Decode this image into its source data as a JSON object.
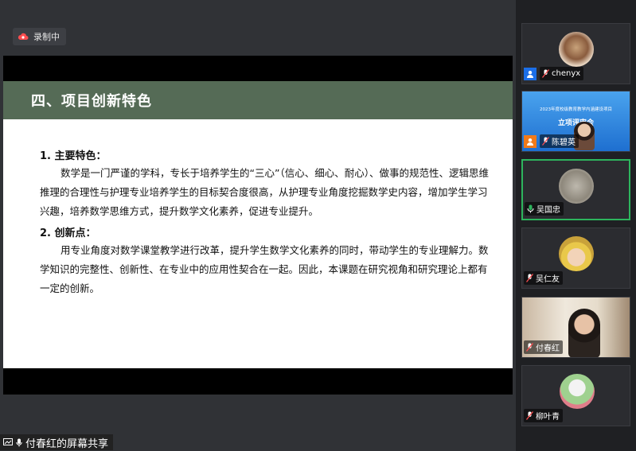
{
  "recording": {
    "label": "录制中"
  },
  "slide": {
    "title": "四、项目创新特色",
    "section1": {
      "heading": "1.  主要特色：",
      "paragraph": "数学是一门严谨的学科，专长于培养学生的“三心”（信心、细心、耐心）、做事的规范性、逻辑思维推理的合理性与护理专业培养学生的目标契合度很高，从护理专业角度挖掘数学史内容，增加学生学习兴趣，培养数学思维方式，提升数学文化素养，促进专业提升。"
    },
    "section2": {
      "heading": "2.   创新点：",
      "paragraph": "用专业角度对数学课堂教学进行改革，提升学生数学文化素养的同时，带动学生的专业理解力。数学知识的完整性、创新性、在专业中的应用性契合在一起。因此，本课题在研究视角和研究理论上都有一定的创新。"
    }
  },
  "screen_share": {
    "label": "付春红的屏幕共享"
  },
  "participants": [
    {
      "name": "chenyx",
      "video_title_line1": "",
      "video_title_line2": ""
    },
    {
      "name": "陈碧英",
      "video_title_line1": "2023年度校级教育教学内涵建设项目",
      "video_title_line2": "立项评审会"
    },
    {
      "name": "吴国忠"
    },
    {
      "name": "吴仁友"
    },
    {
      "name": "付春红"
    },
    {
      "name": "柳叶青"
    }
  ],
  "colors": {
    "slide_header": "#556b56",
    "speaking_border": "#2db55d",
    "host_badge": "#1c6fe8"
  }
}
